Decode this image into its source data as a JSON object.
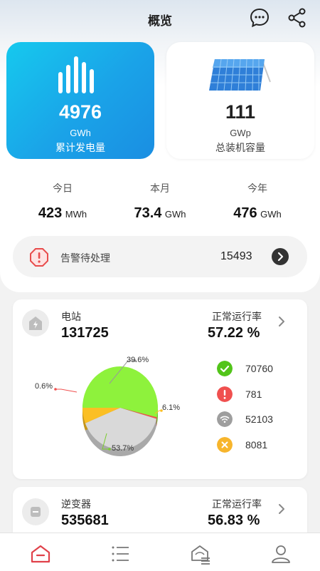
{
  "header": {
    "title": "概览",
    "chat_icon": "chat-bubble-icon",
    "share_icon": "share-icon"
  },
  "summary": {
    "energy": {
      "value": "4976",
      "unit": "GWh",
      "label": "累计发电量",
      "icon": "bar-chart-icon"
    },
    "capacity": {
      "value": "111",
      "unit": "GWp",
      "label": "总装机容量",
      "icon": "solar-panel-icon"
    }
  },
  "periods": [
    {
      "label": "今日",
      "value": "423",
      "unit": "MWh"
    },
    {
      "label": "本月",
      "value": "73.4",
      "unit": "GWh"
    },
    {
      "label": "今年",
      "value": "476",
      "unit": "GWh"
    }
  ],
  "alarm": {
    "label": "告警待处理",
    "count": "15493",
    "icon": "alarm-octagon-icon"
  },
  "station_card": {
    "label": "电站",
    "value": "131725",
    "rate_label": "正常运行率",
    "rate_value": "57.22 %",
    "legend": [
      {
        "status": "normal",
        "icon": "check-icon",
        "color": "#52c41a",
        "value": "70760"
      },
      {
        "status": "fault",
        "icon": "exclamation-icon",
        "color": "#f0504f",
        "value": "781"
      },
      {
        "status": "offline",
        "icon": "wifi-off-icon",
        "color": "#9e9e9e",
        "value": "52103"
      },
      {
        "status": "alarm",
        "icon": "x-icon",
        "color": "#f7b52c",
        "value": "8081"
      }
    ]
  },
  "chart_data": {
    "type": "pie",
    "slices": [
      {
        "label": "53.7%",
        "value": 53.7,
        "color": "#8ef23c"
      },
      {
        "label": "0.6%",
        "value": 0.6,
        "color": "#f0504f"
      },
      {
        "label": "39.6%",
        "value": 39.6,
        "color": "#d9d9d9"
      },
      {
        "label": "6.1%",
        "value": 6.1,
        "color": "#fbbf24"
      }
    ]
  },
  "inverter_card": {
    "label": "逆变器",
    "value": "535681",
    "rate_label": "正常运行率",
    "rate_value": "56.83 %"
  },
  "tabbar": {
    "tabs": [
      "home-icon",
      "list-icon",
      "station-icon",
      "user-icon"
    ],
    "active": "home-icon",
    "accent": "#e0414a"
  }
}
